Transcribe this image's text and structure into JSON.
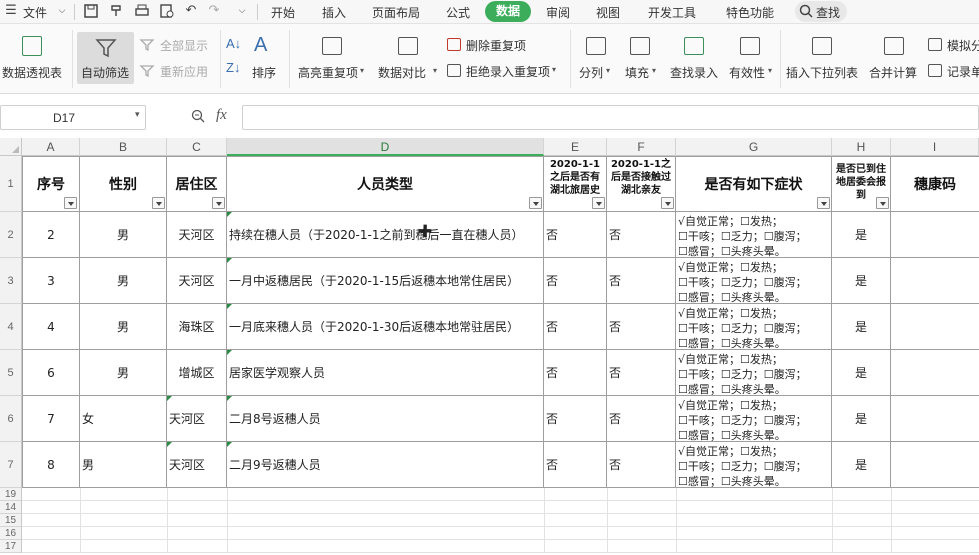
{
  "menubar": {
    "file_label": "文件",
    "tabs": [
      "开始",
      "插入",
      "页面布局",
      "公式",
      "数据",
      "审阅",
      "视图",
      "开发工具",
      "特色功能"
    ],
    "active_tab": "数据",
    "search_label": "查找"
  },
  "ribbon": {
    "pivot": "数据透视表",
    "autofilter": "自动筛选",
    "show_all": "全部显示",
    "reapply": "重新应用",
    "sort": "排序",
    "highlight_dup": "高亮重复项",
    "compare": "数据对比",
    "remove_dup": "删除重复项",
    "reject_dup": "拒绝录入重复项",
    "split": "分列",
    "fill": "填充",
    "lookup": "查找录入",
    "validity": "有效性",
    "dropdown": "插入下拉列表",
    "consolidate": "合并计算",
    "simulate": "模拟分",
    "record": "记录单"
  },
  "formula_bar": {
    "name_box": "D17",
    "fx": "fx",
    "value": ""
  },
  "columns": [
    "A",
    "B",
    "C",
    "D",
    "E",
    "F",
    "G",
    "H",
    "I"
  ],
  "selected_column": "D",
  "header": {
    "row_number": "1",
    "a": "序号",
    "b": "性别",
    "c": "居住区",
    "d": "人员类型",
    "e": "2020-1-1之后是否有湖北旅居史",
    "f": "2020-1-1之后是否接触过湖北亲友",
    "g": "是否有如下症状",
    "h": "是否已到住地居委会报到",
    "i": "穗康码"
  },
  "symptoms": {
    "line1": "√自觉正常；☐发热；",
    "line2": "☐干咳；☐乏力；☐腹泻；",
    "line3": "☐感冒；☐头疼头晕。"
  },
  "rows": [
    {
      "row_number": "2",
      "seq": "2",
      "gender": "男",
      "gender_align": "center",
      "district": "天河区",
      "district_align": "center",
      "type": "持续在穗人员（于2020-1-1之前到穗后一直在穗人员）",
      "hubei": "否",
      "contact": "否",
      "reported": "是"
    },
    {
      "row_number": "3",
      "seq": "3",
      "gender": "男",
      "gender_align": "center",
      "district": "天河区",
      "district_align": "center",
      "type": "一月中返穗居民（于2020-1-15后返穗本地常住居民）",
      "hubei": "否",
      "contact": "否",
      "reported": "是"
    },
    {
      "row_number": "4",
      "seq": "4",
      "gender": "男",
      "gender_align": "center",
      "district": "海珠区",
      "district_align": "center",
      "type": "一月底来穗人员（于2020-1-30后返穗本地常驻居民）",
      "hubei": "否",
      "contact": "否",
      "reported": "是"
    },
    {
      "row_number": "5",
      "seq": "6",
      "gender": "男",
      "gender_align": "center",
      "district": "增城区",
      "district_align": "center",
      "type": "居家医学观察人员",
      "hubei": "否",
      "contact": "否",
      "reported": "是"
    },
    {
      "row_number": "6",
      "seq": "7",
      "gender": "女",
      "gender_align": "left",
      "district": "天河区",
      "district_align": "left",
      "type": "二月8号返穗人员",
      "hubei": "否",
      "contact": "否",
      "reported": "是"
    },
    {
      "row_number": "7",
      "seq": "8",
      "gender": "男",
      "gender_align": "left",
      "district": "天河区",
      "district_align": "left",
      "type": "二月9号返穗人员",
      "hubei": "否",
      "contact": "否",
      "reported": "是"
    }
  ],
  "empty_rows": [
    "19",
    "14",
    "15",
    "16",
    "17"
  ]
}
